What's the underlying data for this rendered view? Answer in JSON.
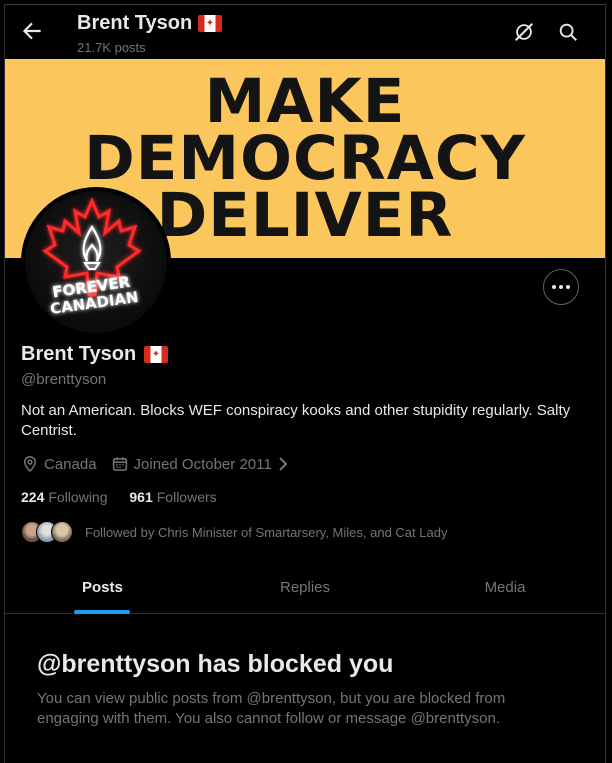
{
  "header": {
    "name": "Brent Tyson",
    "posts_count": "21.7K posts"
  },
  "banner": {
    "lines": [
      "MAKE",
      "DEMOCRACY",
      "DELIVER"
    ],
    "color": "#fbc75c"
  },
  "avatar": {
    "text": "FOREVER CANADIAN"
  },
  "profile": {
    "name": "Brent Tyson",
    "handle": "@brenttyson",
    "bio": "Not an American. Blocks WEF conspiracy kooks and other stupidity regularly. Salty Centrist.",
    "location": "Canada",
    "joined": "Joined October 2011",
    "following_count": "224",
    "following_label": "Following",
    "followers_count": "961",
    "followers_label": "Followers",
    "followed_by": "Followed by Chris Minister of Smartarsery, Miles, and Cat Lady"
  },
  "tabs": [
    {
      "label": "Posts",
      "active": true
    },
    {
      "label": "Replies",
      "active": false
    },
    {
      "label": "Media",
      "active": false
    }
  ],
  "blocked": {
    "title": "@brenttyson has blocked you",
    "description": "You can view public posts from @brenttyson, but you are blocked from engaging with them. You also cannot follow or message @brenttyson."
  },
  "colors": {
    "accent": "#1d9bf0",
    "muted_text": "#71767b"
  },
  "icons": [
    "back-arrow-icon",
    "grok-icon",
    "search-icon",
    "more-icon",
    "location-icon",
    "calendar-icon",
    "chevron-right-icon"
  ]
}
